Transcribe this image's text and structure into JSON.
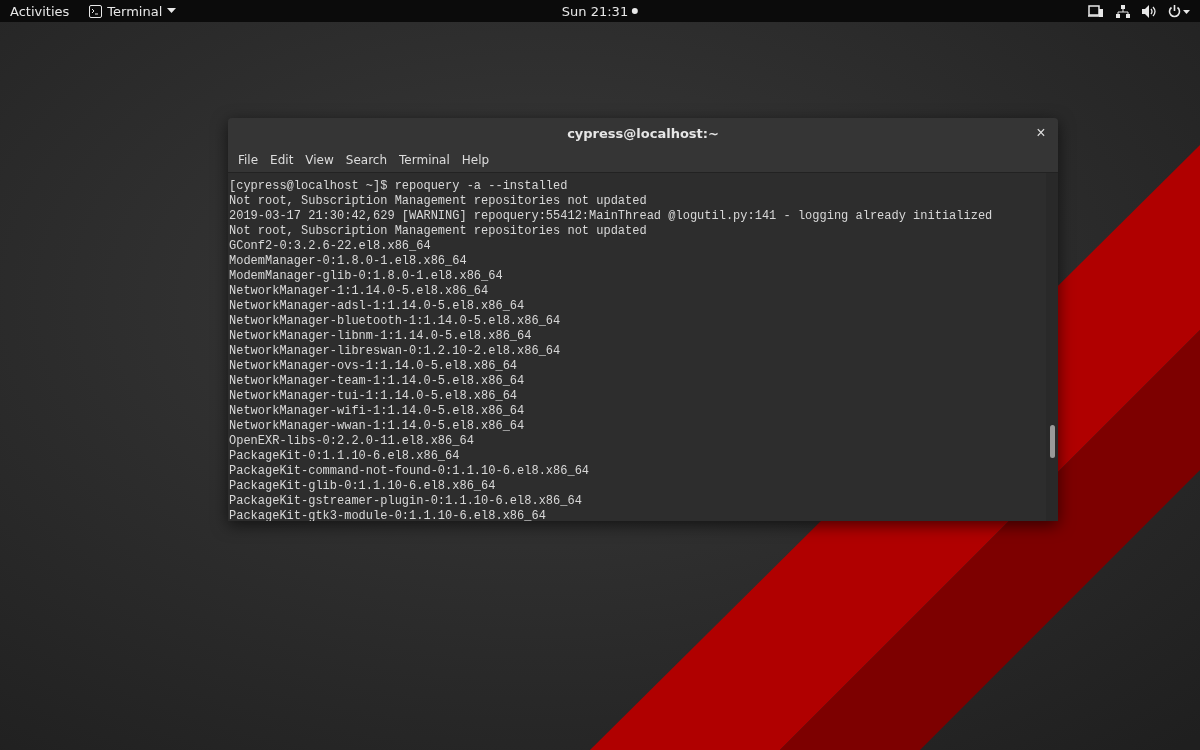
{
  "top_bar": {
    "activities": "Activities",
    "app_menu": "Terminal",
    "clock": "Sun 21:31"
  },
  "window": {
    "title": "cypress@localhost:~",
    "close": "×",
    "menu": [
      "File",
      "Edit",
      "View",
      "Search",
      "Terminal",
      "Help"
    ],
    "lines": [
      "[cypress@localhost ~]$ repoquery -a --installed",
      "Not root, Subscription Management repositories not updated",
      "2019-03-17 21:30:42,629 [WARNING] repoquery:55412:MainThread @logutil.py:141 - logging already initialized",
      "Not root, Subscription Management repositories not updated",
      "GConf2-0:3.2.6-22.el8.x86_64",
      "ModemManager-0:1.8.0-1.el8.x86_64",
      "ModemManager-glib-0:1.8.0-1.el8.x86_64",
      "NetworkManager-1:1.14.0-5.el8.x86_64",
      "NetworkManager-adsl-1:1.14.0-5.el8.x86_64",
      "NetworkManager-bluetooth-1:1.14.0-5.el8.x86_64",
      "NetworkManager-libnm-1:1.14.0-5.el8.x86_64",
      "NetworkManager-libreswan-0:1.2.10-2.el8.x86_64",
      "NetworkManager-ovs-1:1.14.0-5.el8.x86_64",
      "NetworkManager-team-1:1.14.0-5.el8.x86_64",
      "NetworkManager-tui-1:1.14.0-5.el8.x86_64",
      "NetworkManager-wifi-1:1.14.0-5.el8.x86_64",
      "NetworkManager-wwan-1:1.14.0-5.el8.x86_64",
      "OpenEXR-libs-0:2.2.0-11.el8.x86_64",
      "PackageKit-0:1.1.10-6.el8.x86_64",
      "PackageKit-command-not-found-0:1.1.10-6.el8.x86_64",
      "PackageKit-glib-0:1.1.10-6.el8.x86_64",
      "PackageKit-gstreamer-plugin-0:1.1.10-6.el8.x86_64",
      "PackageKit-gtk3-module-0:1.1.10-6.el8.x86_64"
    ]
  }
}
